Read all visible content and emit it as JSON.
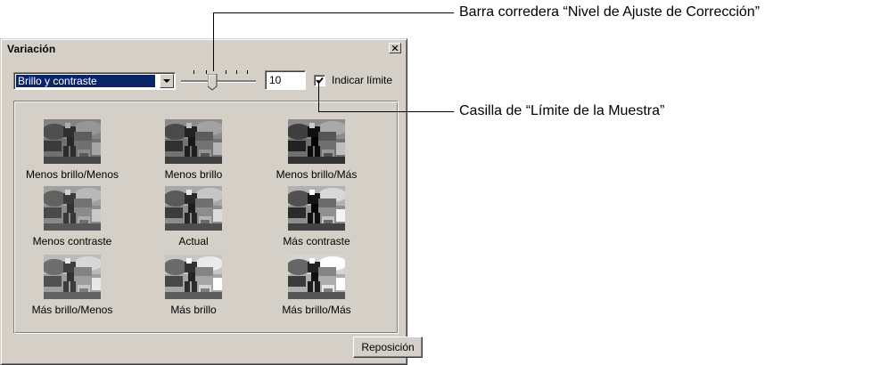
{
  "window": {
    "title": "Variación",
    "toolbar": {
      "mode_select_value": "Brillo y contraste",
      "adjustment_level": "10",
      "show_limit_checked": true,
      "show_limit_label": "Indicar límite"
    },
    "variations": [
      {
        "label": "Menos brillo/Menos",
        "brightness": 0.78,
        "contrast": 0.85
      },
      {
        "label": "Menos brillo",
        "brightness": 0.82,
        "contrast": 1.0
      },
      {
        "label": "Menos brillo/Más",
        "brightness": 0.82,
        "contrast": 1.2
      },
      {
        "label": "Menos contraste",
        "brightness": 1.0,
        "contrast": 0.8
      },
      {
        "label": "Actual",
        "brightness": 1.0,
        "contrast": 1.0
      },
      {
        "label": "Más contraste",
        "brightness": 1.0,
        "contrast": 1.25
      },
      {
        "label": "Más brillo/Menos",
        "brightness": 1.18,
        "contrast": 0.82
      },
      {
        "label": "Más brillo",
        "brightness": 1.18,
        "contrast": 1.0
      },
      {
        "label": "Más brillo/Más",
        "brightness": 1.18,
        "contrast": 1.2
      }
    ],
    "reset_button_label": "Reposición"
  },
  "callouts": {
    "slider": "Barra corredera “Nivel de Ajuste de Corrección”",
    "checkbox": "Casilla de “Límite de la Muestra”"
  }
}
